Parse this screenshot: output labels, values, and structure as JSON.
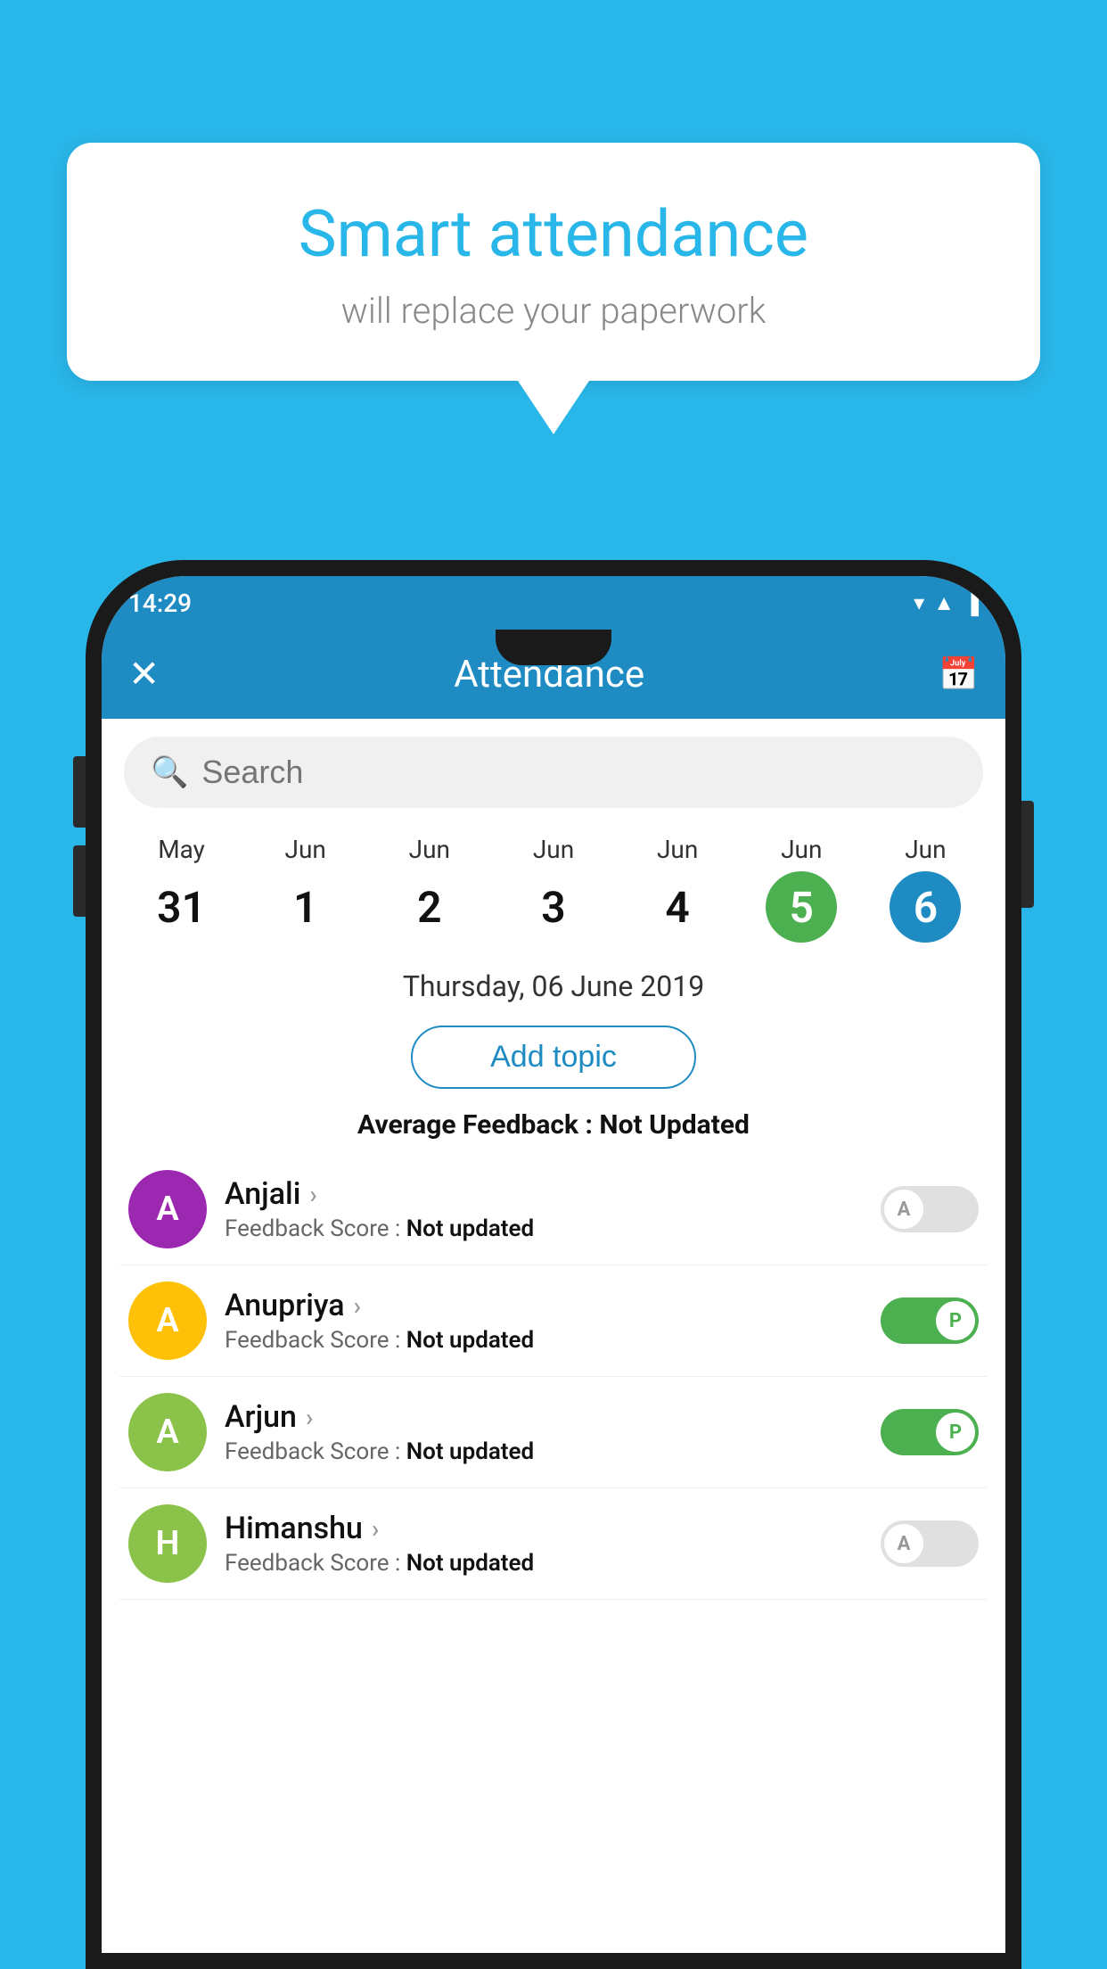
{
  "page": {
    "background_color": "#29b6e8"
  },
  "speech_bubble": {
    "title": "Smart attendance",
    "subtitle": "will replace your paperwork"
  },
  "status_bar": {
    "time": "14:29",
    "wifi_icon": "▾",
    "signal_icon": "▲",
    "battery_icon": "▐"
  },
  "app_bar": {
    "close_label": "✕",
    "title": "Attendance",
    "calendar_icon": "📅"
  },
  "search": {
    "placeholder": "Search"
  },
  "calendar": {
    "days": [
      {
        "month": "May",
        "date": "31",
        "type": "normal"
      },
      {
        "month": "Jun",
        "date": "1",
        "type": "normal"
      },
      {
        "month": "Jun",
        "date": "2",
        "type": "normal"
      },
      {
        "month": "Jun",
        "date": "3",
        "type": "normal"
      },
      {
        "month": "Jun",
        "date": "4",
        "type": "normal"
      },
      {
        "month": "Jun",
        "date": "5",
        "type": "today"
      },
      {
        "month": "Jun",
        "date": "6",
        "type": "selected"
      }
    ],
    "selected_date_label": "Thursday, 06 June 2019"
  },
  "add_topic_button": "Add topic",
  "average_feedback": {
    "label": "Average Feedback : ",
    "value": "Not Updated"
  },
  "students": [
    {
      "name": "Anjali",
      "avatar_letter": "A",
      "avatar_color": "#9c27b0",
      "feedback_label": "Feedback Score : ",
      "feedback_value": "Not updated",
      "toggle_state": "off",
      "toggle_label": "A"
    },
    {
      "name": "Anupriya",
      "avatar_letter": "A",
      "avatar_color": "#ffc107",
      "feedback_label": "Feedback Score : ",
      "feedback_value": "Not updated",
      "toggle_state": "on",
      "toggle_label": "P"
    },
    {
      "name": "Arjun",
      "avatar_letter": "A",
      "avatar_color": "#8bc34a",
      "feedback_label": "Feedback Score : ",
      "feedback_value": "Not updated",
      "toggle_state": "on",
      "toggle_label": "P"
    },
    {
      "name": "Himanshu",
      "avatar_letter": "H",
      "avatar_color": "#8bc34a",
      "feedback_label": "Feedback Score : ",
      "feedback_value": "Not updated",
      "toggle_state": "off",
      "toggle_label": "A"
    }
  ]
}
